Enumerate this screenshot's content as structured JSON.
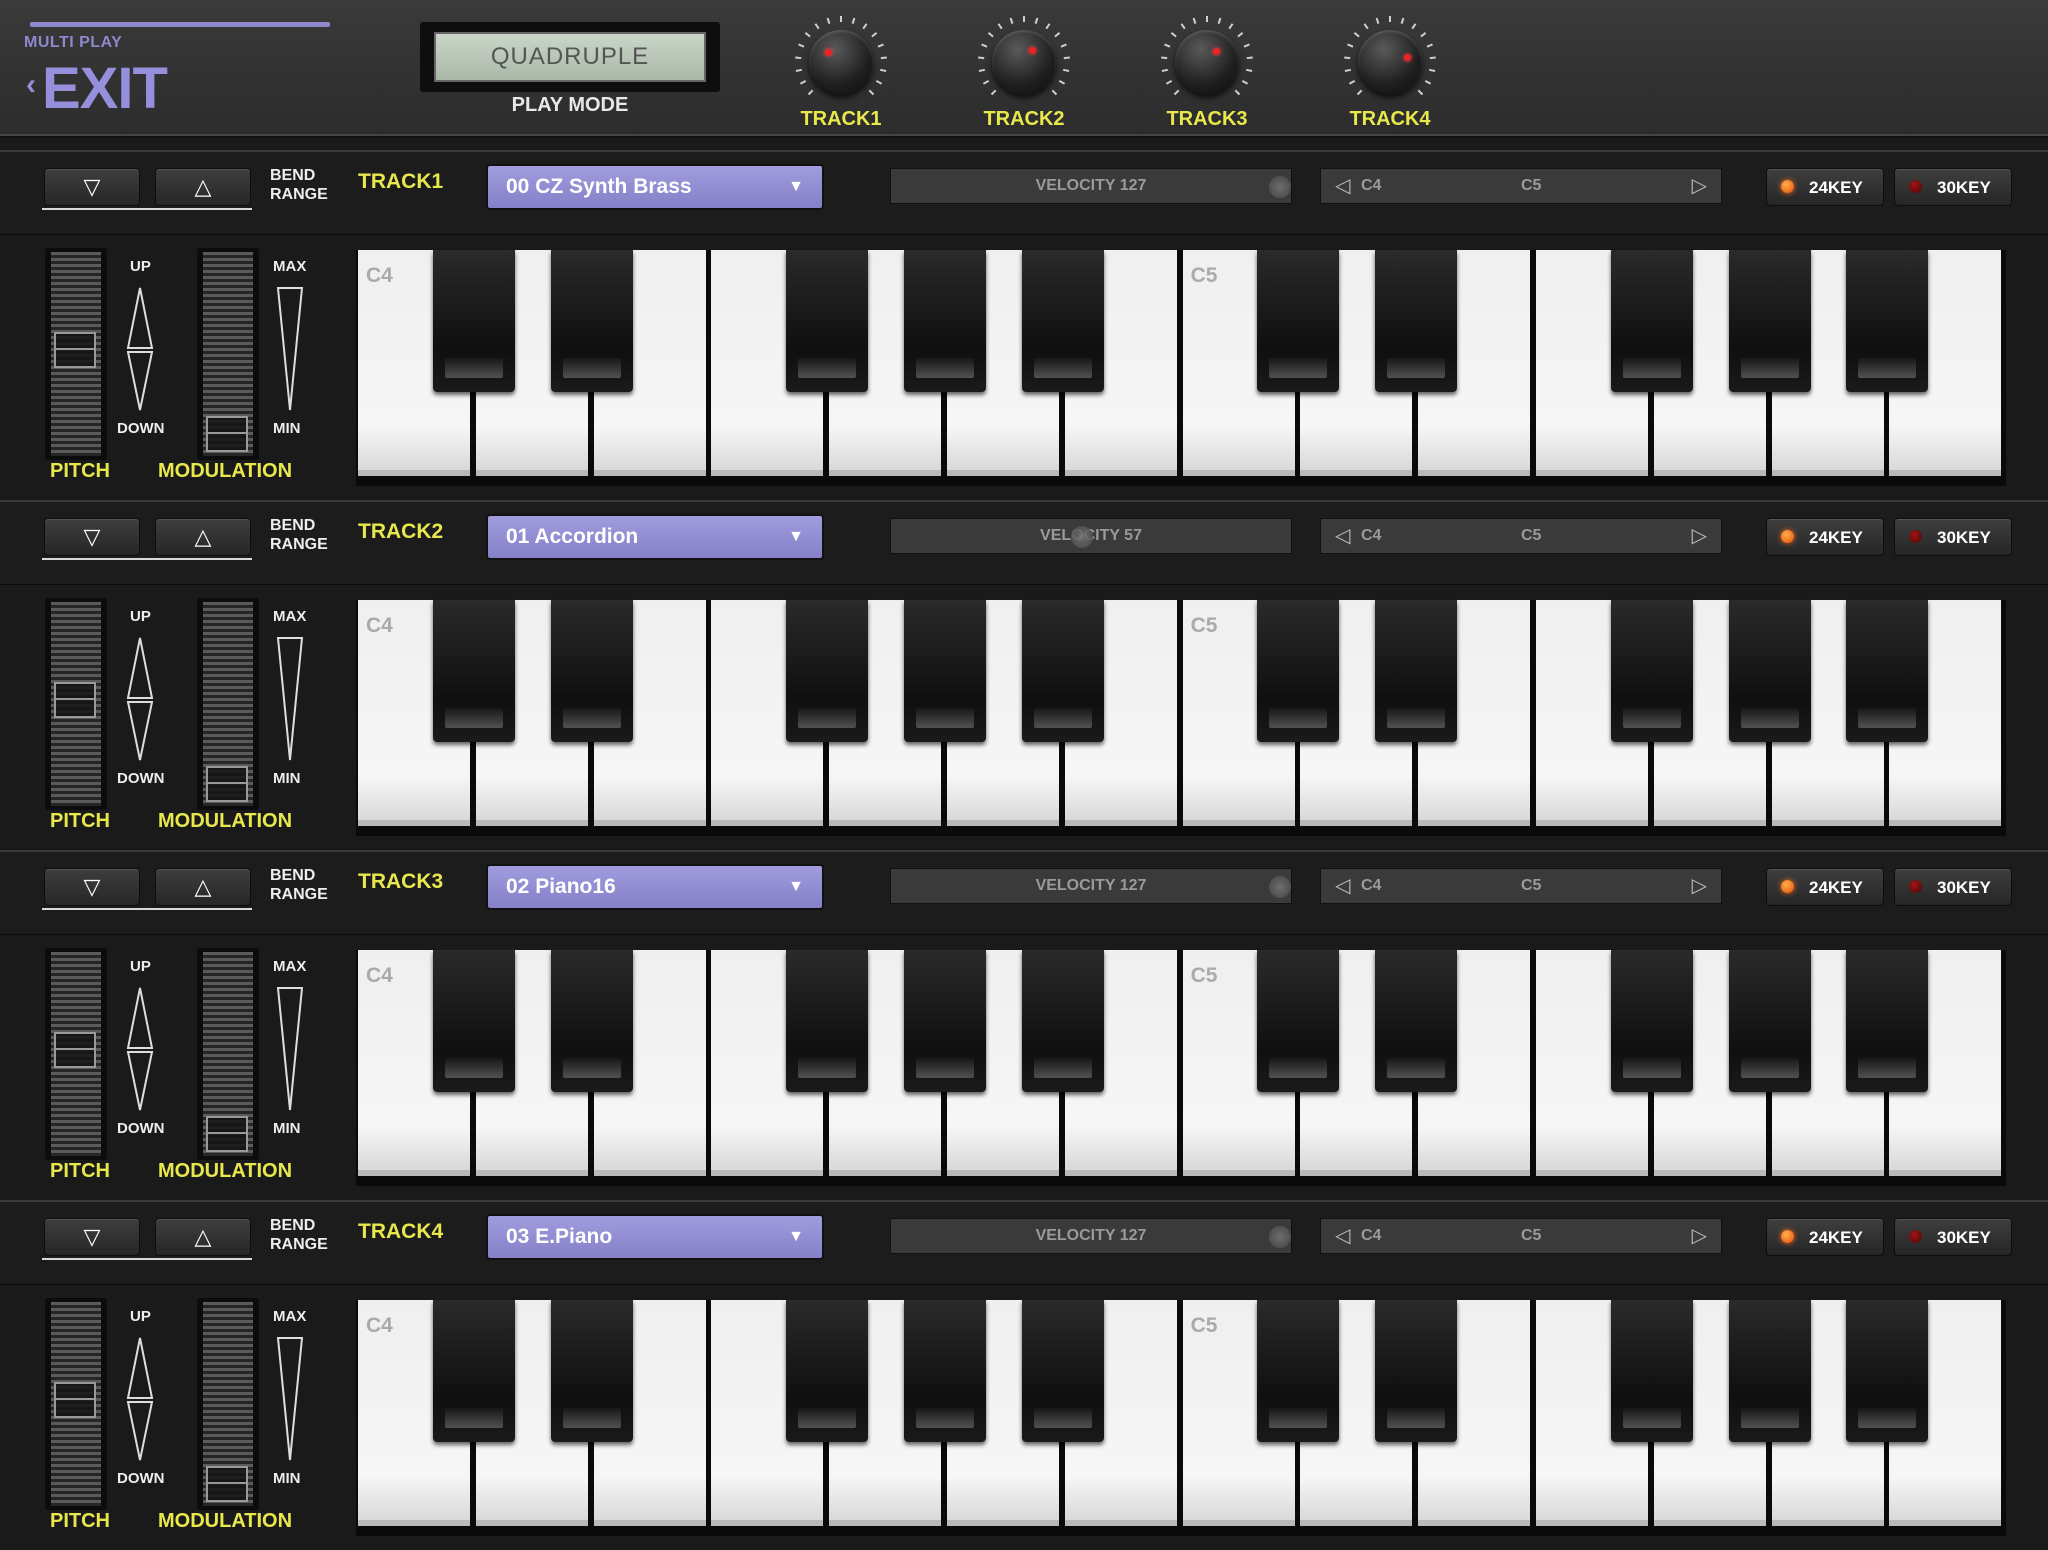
{
  "header": {
    "subtitle": "MULTI PLAY",
    "exit_label": "EXIT",
    "play_mode_value": "QUADRUPLE",
    "play_mode_label": "PLAY MODE",
    "knobs": [
      {
        "label": "TRACK1",
        "icon": "knob-icon"
      },
      {
        "label": "TRACK2",
        "icon": "knob-icon"
      },
      {
        "label": "TRACK3",
        "icon": "knob-icon"
      },
      {
        "label": "TRACK4",
        "icon": "knob-icon"
      }
    ]
  },
  "tracks": [
    {
      "name": "TRACK1",
      "bend_label_1": "BEND",
      "bend_label_2": "RANGE",
      "tone": "00 CZ Synth Brass",
      "velocity": "VELOCITY 127",
      "octave_low": "C4",
      "octave_high": "C5",
      "key24": "24KEY",
      "key30": "30KEY",
      "pitch_up": "UP",
      "pitch_down": "DOWN",
      "mod_max": "MAX",
      "mod_min": "MIN",
      "pitch_label": "PITCH",
      "mod_label": "MODULATION",
      "note_labels": [
        "C4",
        "C5"
      ]
    },
    {
      "name": "TRACK2",
      "bend_label_1": "BEND",
      "bend_label_2": "RANGE",
      "tone": "01 Accordion",
      "velocity": "VELOCITY 57",
      "octave_low": "C4",
      "octave_high": "C5",
      "key24": "24KEY",
      "key30": "30KEY",
      "pitch_up": "UP",
      "pitch_down": "DOWN",
      "mod_max": "MAX",
      "mod_min": "MIN",
      "pitch_label": "PITCH",
      "mod_label": "MODULATION",
      "note_labels": [
        "C4",
        "C5"
      ]
    },
    {
      "name": "TRACK3",
      "bend_label_1": "BEND",
      "bend_label_2": "RANGE",
      "tone": "02 Piano16",
      "velocity": "VELOCITY 127",
      "octave_low": "C4",
      "octave_high": "C5",
      "key24": "24KEY",
      "key30": "30KEY",
      "pitch_up": "UP",
      "pitch_down": "DOWN",
      "mod_max": "MAX",
      "mod_min": "MIN",
      "pitch_label": "PITCH",
      "mod_label": "MODULATION",
      "note_labels": [
        "C4",
        "C5"
      ]
    },
    {
      "name": "TRACK4",
      "bend_label_1": "BEND",
      "bend_label_2": "RANGE",
      "tone": "03 E.Piano",
      "velocity": "VELOCITY 127",
      "octave_low": "C4",
      "octave_high": "C5",
      "key24": "24KEY",
      "key30": "30KEY",
      "pitch_up": "UP",
      "pitch_down": "DOWN",
      "mod_max": "MAX",
      "mod_min": "MIN",
      "pitch_label": "PITCH",
      "mod_label": "MODULATION",
      "note_labels": [
        "C4",
        "C5"
      ]
    }
  ],
  "colors": {
    "accent": "#8e88cc",
    "label_yellow": "#e8e84c",
    "led_on": "#ff6a1a",
    "led_off": "#8a0e0e"
  }
}
